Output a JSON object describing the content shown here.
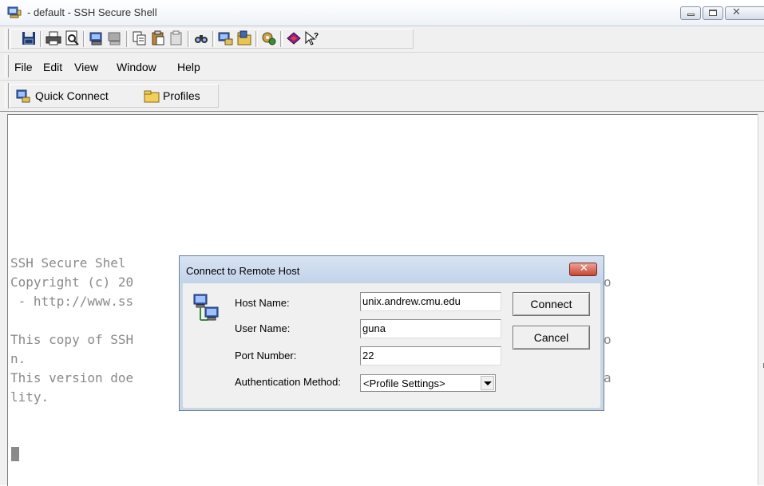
{
  "window": {
    "title": "- default - SSH Secure Shell"
  },
  "menu": {
    "file": "File",
    "edit": "Edit",
    "view": "View",
    "window": "Window",
    "help": "Help"
  },
  "quickbar": {
    "quick_connect": "Quick Connect",
    "profiles": "Profiles"
  },
  "terminal": {
    "lines": [
      "SSH Secure Shel",
      "Copyright (c) 20",
      " - http://www.ss",
      "",
      "This copy of SSH",
      "n.",
      "This version doe",
      "lity."
    ],
    "right_fragments": [
      "o",
      "o",
      "a"
    ]
  },
  "dialog": {
    "title": "Connect to Remote Host",
    "close_glyph": "✕",
    "host_label": "Host Name:",
    "host_value": "unix.andrew.cmu.edu",
    "user_label": "User Name:",
    "user_value": "guna",
    "port_label": "Port Number:",
    "port_value": "22",
    "auth_label": "Authentication Method:",
    "auth_value": "<Profile Settings>",
    "connect_label": "Connect",
    "cancel_label": "Cancel"
  },
  "colors": {
    "terminal_text": "#8a8a8a",
    "dialog_frame": "#c9d6e6",
    "close_button": "#c8462f"
  },
  "icons": {
    "toolbar": [
      "save-icon",
      "print-icon",
      "print-preview-icon",
      "connect-icon",
      "disconnect-icon",
      "copy-icon",
      "paste-icon",
      "paste-special-icon",
      "find-icon",
      "new-terminal-icon",
      "new-file-transfer-icon",
      "settings-icon",
      "help-book-icon",
      "context-help-icon"
    ]
  }
}
